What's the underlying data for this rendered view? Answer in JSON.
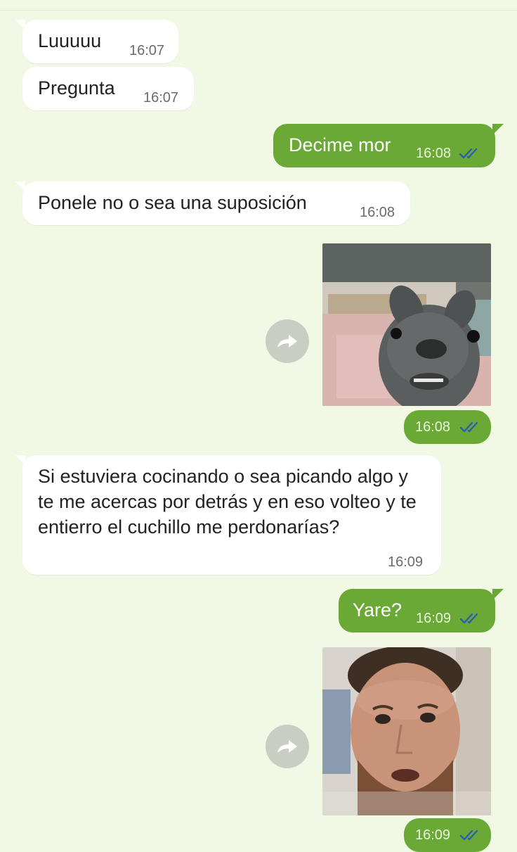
{
  "messages": [
    {
      "id": "m1",
      "direction": "in",
      "text": "Luuuuu",
      "time": "16:07"
    },
    {
      "id": "m2",
      "direction": "in",
      "text": "Pregunta",
      "time": "16:07"
    },
    {
      "id": "m3",
      "direction": "out",
      "text": "Decime mor",
      "time": "16:08",
      "status": "read"
    },
    {
      "id": "m4",
      "direction": "in",
      "text": "Ponele no o sea una suposición",
      "time": "16:08"
    },
    {
      "id": "m5",
      "direction": "out",
      "type": "sticker",
      "sticker": "puppy-sticker",
      "time": "16:08",
      "status": "read"
    },
    {
      "id": "m6",
      "direction": "in",
      "text": "Si estuviera cocinando o sea picando algo y te me acercas por detrás y en eso volteo y te entierro el cuchillo me perdonarías?",
      "time": "16:09"
    },
    {
      "id": "m7",
      "direction": "out",
      "text": "Yare?",
      "time": "16:09",
      "status": "read"
    },
    {
      "id": "m8",
      "direction": "out",
      "type": "sticker",
      "sticker": "man-face-sticker",
      "time": "16:09",
      "status": "read"
    }
  ],
  "colors": {
    "background": "#f1f8e4",
    "outgoing_bubble": "#6aa935",
    "incoming_bubble": "#ffffff",
    "read_ticks": "#2a5fb0"
  },
  "icons": {
    "forward": "forward-arrow-icon",
    "read_status": "double-check-icon"
  }
}
